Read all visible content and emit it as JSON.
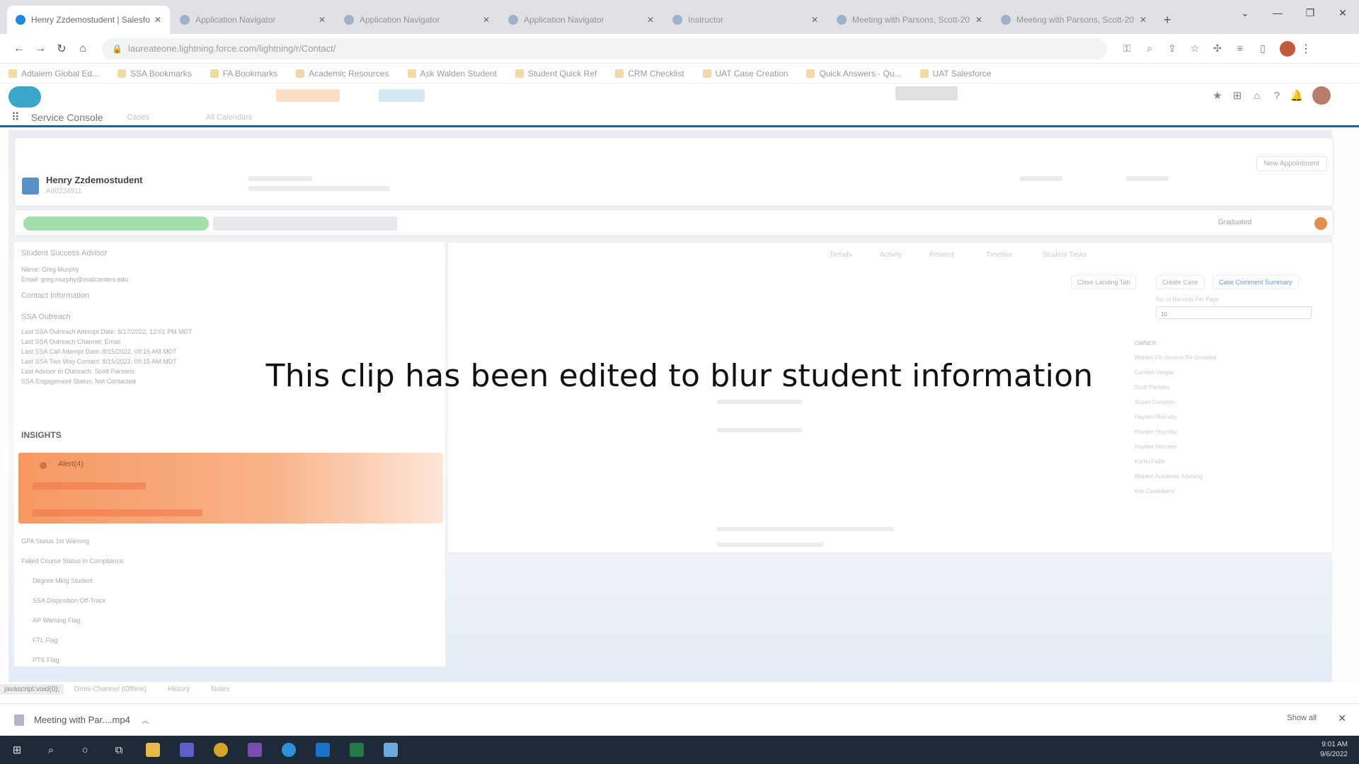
{
  "browser": {
    "tabs": [
      {
        "label": "Henry Zzdemostudent | Salesfo",
        "active": true
      },
      {
        "label": "Application Navigator",
        "active": false
      },
      {
        "label": "Application Navigator",
        "active": false
      },
      {
        "label": "Application Navigator",
        "active": false
      },
      {
        "label": "Instructor",
        "active": false
      },
      {
        "label": "Meeting with Parsons, Scott-20",
        "active": false
      },
      {
        "label": "Meeting with Parsons, Scott-20",
        "active": false
      }
    ],
    "url": "laureateone.lightning.force.com/lightning/r/Contact/",
    "bookmarks": [
      "Adtalem Global Ed...",
      "SSA Bookmarks",
      "FA Bookmarks",
      "Academic Resources",
      "Ask Walden Student",
      "Student Quick Ref",
      "CRM Checklist",
      "UAT Case Creation",
      "Quick Answers - Qu...",
      "UAT Salesforce"
    ]
  },
  "salesforce": {
    "app_name": "Service Console",
    "nav_tabs": [
      "Cases",
      "All Calendars"
    ]
  },
  "record": {
    "name": "Henry Zzdemostudent",
    "sub": "A00234911",
    "new_appointment_label": "New Appointment",
    "path_current": "Graduated"
  },
  "left": {
    "advisor_section": "Student Success Advisor",
    "name_row": "Name: Greg Murphy",
    "email_row": "Email: greg.murphy@mailcanters.edu",
    "contact_section": "Contact Information",
    "outreach_section": "SSA Outreach",
    "outreach_rows": [
      "Last SSA Outreach Attempt Date: 8/17/2022, 12:01 PM MDT",
      "Last SSA Outreach Channel: Email",
      "Last SSA Call Attempt Date: 8/15/2022, 09:15 AM MDT",
      "Last SSA Two Way Contact: 8/15/2022, 09:15 AM MDT",
      "Last Advisor to Outreach: Scott Parsons",
      "SSA Engagement Status: Not Contacted"
    ],
    "insights_label": "INSIGHTS",
    "alert_title": "Alert(4)",
    "status_rows": [
      "GPA Status  1st Warning",
      "Failed Course Status  In Compliance",
      "Degree Mktg Student",
      "SSA Disposition  Off-Track",
      "AP Warning Flag",
      "FTL Flag",
      "PTS Flag"
    ]
  },
  "right": {
    "tabs": [
      "Details",
      "Activity",
      "Related",
      "Timeline",
      "Student Tasks"
    ],
    "buttons": [
      "Close Landing Tab",
      "Create Case",
      "Case Comment Summary"
    ],
    "records_per_page_label": "No. of Records Per Page",
    "records_per_page_value": "10",
    "owner_header": "OWNER",
    "owners": [
      "Walden Fin Service Re-Disabled",
      "Carmen Vargas",
      "Scott Parsons",
      "Susan Compton",
      "Hayden Hornsby",
      "Hayden Hornsby",
      "Hayden Hornsby",
      "Karen Faille",
      "Walden Academic Advising",
      "Kim Castleberry"
    ]
  },
  "caption": "This clip has been edited to blur student information",
  "utility": {
    "status_url": "javascript:void(0);",
    "items": [
      "Omni-Channel (Offline)",
      "History",
      "Notes"
    ]
  },
  "download": {
    "filename": "Meeting with Par....mp4",
    "show_all": "Show all"
  },
  "clock": {
    "time": "9:01 AM",
    "date": "9/6/2022"
  }
}
